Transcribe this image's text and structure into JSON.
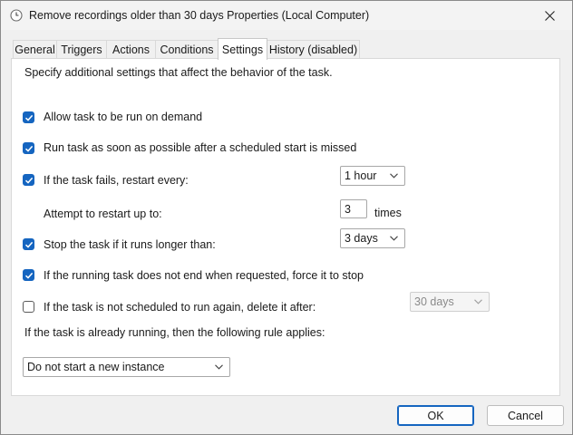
{
  "window": {
    "title": "Remove recordings older than 30 days Properties (Local Computer)"
  },
  "tabs": [
    {
      "label": "General"
    },
    {
      "label": "Triggers"
    },
    {
      "label": "Actions"
    },
    {
      "label": "Conditions"
    },
    {
      "label": "Settings",
      "active": true
    },
    {
      "label": "History (disabled)"
    }
  ],
  "settings": {
    "intro": "Specify additional settings that affect the behavior of the task.",
    "allow_on_demand": {
      "label": "Allow task to be run on demand",
      "checked": true
    },
    "run_asap": {
      "label": "Run task as soon as possible after a scheduled start is missed",
      "checked": true
    },
    "restart_on_fail": {
      "label": "If the task fails, restart every:",
      "checked": true,
      "value": "1 hour"
    },
    "restart_attempts": {
      "label": "Attempt to restart up to:",
      "value": "3",
      "unit": "times"
    },
    "stop_if_longer": {
      "label": "Stop the task if it runs longer than:",
      "checked": true,
      "value": "3 days"
    },
    "force_stop": {
      "label": "If the running task does not end when requested, force it to stop",
      "checked": true
    },
    "delete_if_not_scheduled": {
      "label": "If the task is not scheduled to run again, delete it after:",
      "checked": false,
      "value": "30 days"
    },
    "running_rule_label": "If the task is already running, then the following rule applies:",
    "running_rule_value": "Do not start a new instance"
  },
  "buttons": {
    "ok": "OK",
    "cancel": "Cancel"
  },
  "colors": {
    "accent": "#1565c0"
  }
}
